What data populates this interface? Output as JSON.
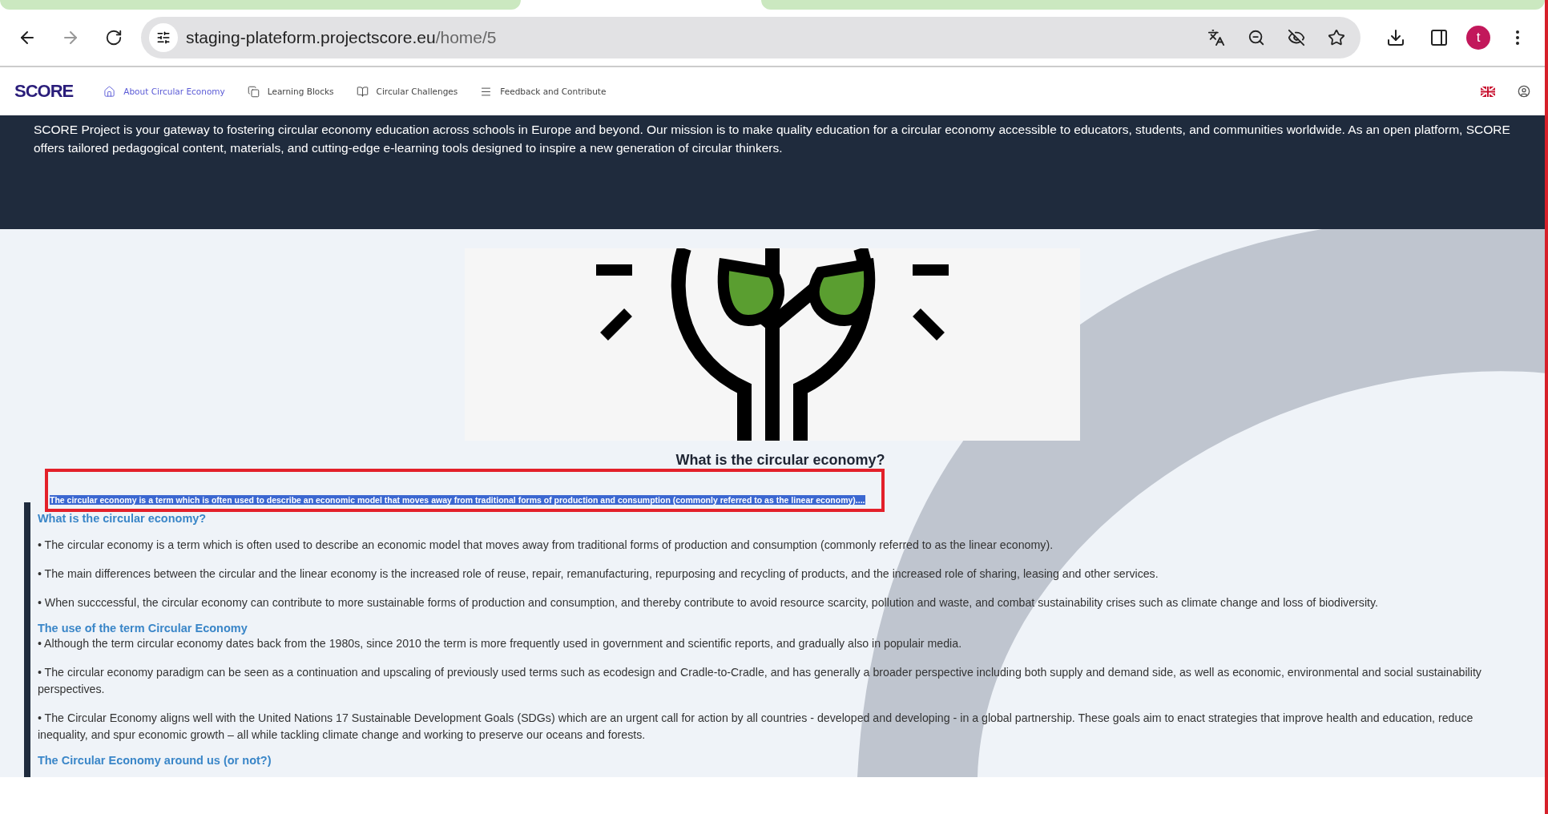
{
  "browser": {
    "url_host": "staging-plateform.projectscore.eu",
    "url_path": "/home/5",
    "avatar_letter": "t"
  },
  "nav": {
    "logo": "SCORE",
    "items": [
      {
        "label": "About Circular Economy",
        "selected": true,
        "kind": "home"
      },
      {
        "label": "Learning Blocks",
        "selected": false,
        "kind": "copy"
      },
      {
        "label": "Circular Challenges",
        "selected": false,
        "kind": "book"
      },
      {
        "label": "Feedback and Contribute",
        "selected": false,
        "kind": "menu"
      }
    ]
  },
  "hero": {
    "text": "SCORE Project is your gateway to fostering circular economy education across schools in Europe and beyond. Our mission is to make quality education for a circular economy accessible to educators, students, and communities worldwide. As an open platform, SCORE offers tailored pedagogical content, materials, and cutting-edge e-learning tools designed to inspire a new generation of circular thinkers."
  },
  "section": {
    "title": "What is the circular economy?",
    "excerpt": {
      "text": "The circular economy is a term which is often used to describe an economic model that moves away from traditional forms of production and consumption (commonly referred to as the linear economy)....",
      "selected": true
    },
    "blocks": [
      {
        "kind": "heading",
        "text": "What is the circular economy?"
      },
      {
        "kind": "bullet",
        "text": "• The circular economy is a term which is often used to describe an economic model that moves away from traditional forms of production and consumption (commonly referred to as the linear economy)."
      },
      {
        "kind": "bullet",
        "text": "• The main differences between the circular and the linear economy is the increased role of reuse, repair, remanufacturing, repurposing and recycling of products, and the increased role of sharing, leasing and other services."
      },
      {
        "kind": "bullet",
        "text": "• When succcessful, the circular economy can contribute to more sustainable forms of production and consumption, and thereby contribute to avoid resource scarcity, pollution and waste, and combat sustainability crises such as climate change and loss of biodiversity."
      },
      {
        "kind": "heading",
        "text": "The use of the term Circular Economy"
      },
      {
        "kind": "bullet",
        "text": "• Although the term circular economy dates back from the 1980s, since 2010 the term is more frequently used in government and scientific reports, and gradually also in populair media."
      },
      {
        "kind": "bullet",
        "text": "• The circular economy paradigm can be seen as a continuation and upscaling of previously used terms such as ecodesign and Cradle-to-Cradle, and has generally a broader perspective including both supply and demand side, as well as economic, environmental and social sustainability perspectives."
      },
      {
        "kind": "bullet",
        "text": "• The Circular Economy aligns well with the United Nations 17 Sustainable Development Goals (SDGs) which are an urgent call for action by all countries - developed and developing - in a global partnership. These goals aim to enact strategies that improve health and education, reduce inequality, and spur economic growth – all while tackling climate change and working to preserve our oceans and forests."
      },
      {
        "kind": "heading",
        "text": "The Circular Economy around us (or not?)"
      }
    ]
  }
}
